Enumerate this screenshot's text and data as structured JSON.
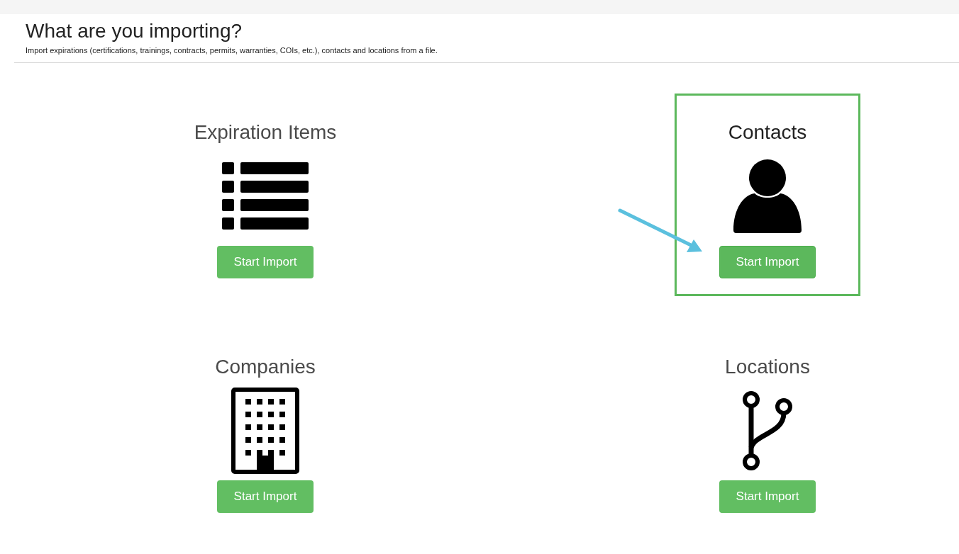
{
  "header": {
    "title": "What are you importing?",
    "subtitle": "Import expirations (certifications, trainings, contracts, permits, warranties, COIs, etc.), contacts and locations from a file."
  },
  "import_options": [
    {
      "title": "Expiration Items",
      "kind": "list",
      "button": "Start Import",
      "highlighted": false
    },
    {
      "title": "Contacts",
      "kind": "person",
      "button": "Start Import",
      "highlighted": true
    },
    {
      "title": "Companies",
      "kind": "building",
      "button": "Start Import",
      "highlighted": false
    },
    {
      "title": "Locations",
      "kind": "branch",
      "button": "Start Import",
      "highlighted": false
    }
  ]
}
